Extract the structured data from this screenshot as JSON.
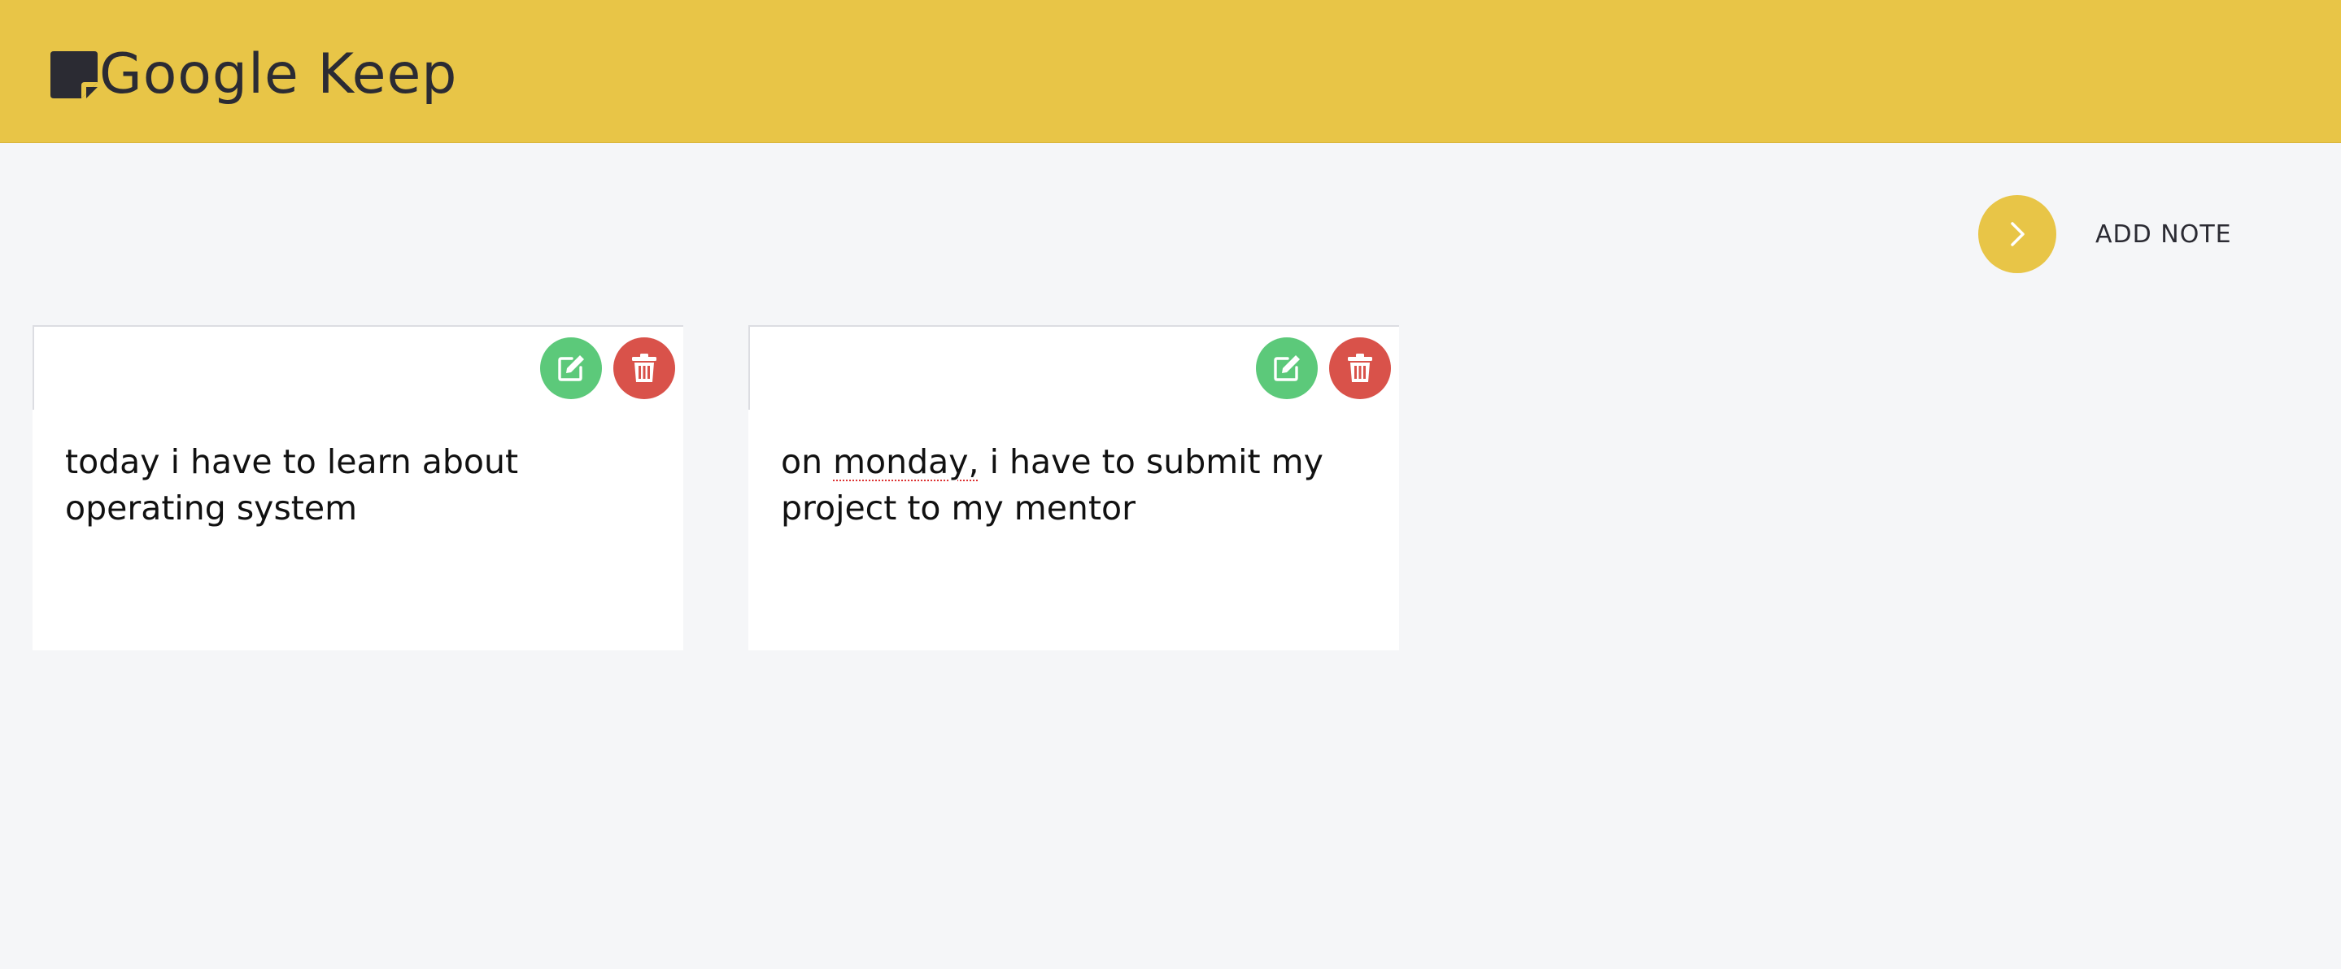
{
  "app": {
    "title": "Google Keep",
    "logo_icon": "sticky-note-icon",
    "accent_color": "#e8c547"
  },
  "toolbar": {
    "add_label": "ADD NOTE",
    "add_icon": "chevron-right-icon"
  },
  "notes": [
    {
      "text": "today i have to learn about operating system",
      "edit_icon": "edit-icon",
      "delete_icon": "trash-icon"
    },
    {
      "text_before": "on ",
      "text_flagged": "monday,",
      "text_after": " i have to submit my project to my mentor",
      "edit_icon": "edit-icon",
      "delete_icon": "trash-icon"
    }
  ],
  "colors": {
    "edit_button": "#5cc97a",
    "delete_button": "#d9524a",
    "background": "#f5f6f8"
  }
}
